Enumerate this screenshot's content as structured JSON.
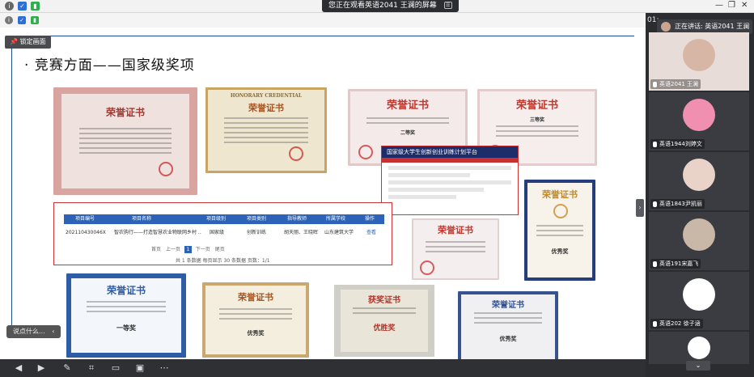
{
  "app": {
    "banner": "您正在观看英语2041 王澜的屏幕",
    "pin_label": "锁定画面",
    "chat_placeholder": "说点什么...",
    "timer": "01:",
    "window_controls": [
      "—",
      "❐",
      "✕"
    ]
  },
  "slide": {
    "title": "· 竞赛方面——国家级奖项"
  },
  "certificates": {
    "c1_title": "荣誉证书",
    "c2_title_en": "HONORARY CREDENTIAL",
    "c2_title": "荣誉证书",
    "c3_title": "荣誉证书",
    "c4_title": "荣誉证书",
    "c5_title": "荣誉证书",
    "c6_title": "荣誉证书",
    "c6_award": "优秀奖",
    "c7_title": "荣誉证书",
    "c7_award": "一等奖",
    "c8_title": "荣誉证书",
    "c8_award": "优秀奖",
    "c9_title": "获奖证书",
    "c9_award": "优胜奖",
    "c10_title": "荣誉证书",
    "c10_award": "优秀奖",
    "c3_prize": "二等奖",
    "c4_prize": "三等奖"
  },
  "platform": {
    "header": "国家级大学生创新创业训练计划平台"
  },
  "table": {
    "headers": [
      "项目编号",
      "项目名称",
      "项目级别",
      "项目类别",
      "指导教师",
      "所属学校",
      "操作"
    ],
    "row": [
      "202110430046X",
      "智农购行——打造智慧农业物联网乡村 ...",
      "国家级",
      "创新训练",
      "胡天丽、王晓晖",
      "山东建筑大学",
      "查看"
    ],
    "pager": [
      "首页",
      "上一页",
      "1",
      "下一页",
      "尾页"
    ],
    "summary": "共 1 条数据  每页显示 30 条数据  页数：1/1"
  },
  "participants": {
    "speaking": "正在讲话: 英语2041 王澜",
    "tiles": [
      {
        "name": "英语2041 王澜"
      },
      {
        "name": "英语1944刘婷文"
      },
      {
        "name": "英语1843尹凯丽"
      },
      {
        "name": "英语191宋嘉飞"
      },
      {
        "name": "英语202 徐子涵"
      },
      {
        "name": ""
      }
    ]
  }
}
